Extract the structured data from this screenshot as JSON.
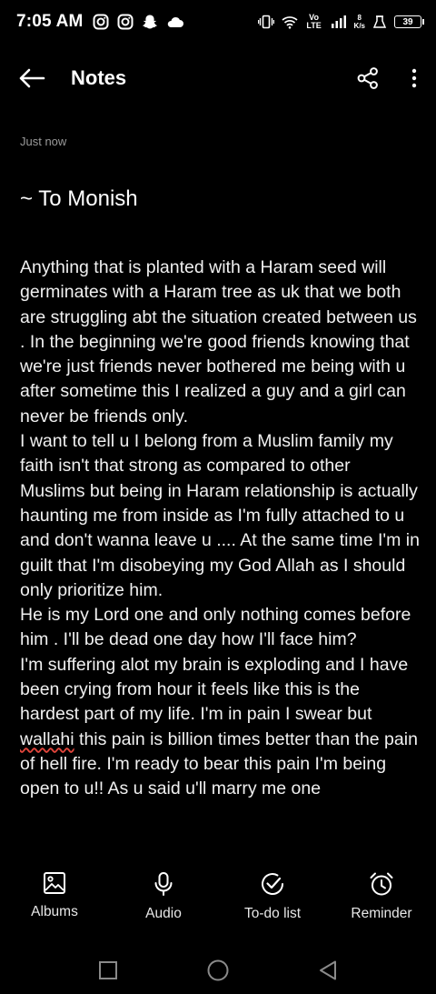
{
  "status_bar": {
    "time": "7:05 AM",
    "icons_left": [
      "instagram-icon",
      "instagram-icon",
      "snapchat-icon",
      "cloud-icon"
    ],
    "icons_right": [
      "vibrate-icon",
      "wifi-icon",
      "volte-icon",
      "signal-icon",
      "net-speed",
      "alarm-icon",
      "battery-icon"
    ],
    "volte": "Vo LTE",
    "net_speed_value": "8",
    "net_speed_unit": "K/s",
    "battery": "39"
  },
  "app_bar": {
    "title": "Notes",
    "back_icon": "arrow-left-icon",
    "share_icon": "share-icon",
    "more_icon": "more-vertical-icon"
  },
  "note": {
    "timestamp": "Just now",
    "title": "~ To Monish",
    "body_before": "Anything that is planted with a Haram seed will germinates with a Haram tree as uk that we both are struggling abt the situation created between us . In the beginning we're good friends knowing that we're just friends never bothered me being with u after sometime this I realized a guy and a girl can never be friends only.\nI want to tell u I belong from a Muslim family my faith isn't that strong as compared to other Muslims but being in Haram relationship is actually haunting me from inside as I'm fully attached to u and don't wanna leave u .... At the same time I'm in guilt that I'm disobeying my God Allah as I should only prioritize him.\nHe is my Lord one and only nothing comes before him . I'll be dead one day how I'll face him?\nI'm suffering alot my brain is exploding and I have been crying from hour it feels like this is the hardest part of my life. I'm in pain I swear but ",
    "body_flagged": "wallahi",
    "body_after": " this pain is billion times better than the pain of hell fire. I'm ready to bear this pain I'm being open to u!! As u said u'll marry me one"
  },
  "toolbar": [
    {
      "label": "Albums",
      "icon": "image-icon"
    },
    {
      "label": "Audio",
      "icon": "microphone-icon"
    },
    {
      "label": "To-do list",
      "icon": "check-circle-icon"
    },
    {
      "label": "Reminder",
      "icon": "alarm-clock-icon"
    }
  ],
  "nav": [
    "recents-square-icon",
    "home-circle-icon",
    "back-triangle-icon"
  ]
}
